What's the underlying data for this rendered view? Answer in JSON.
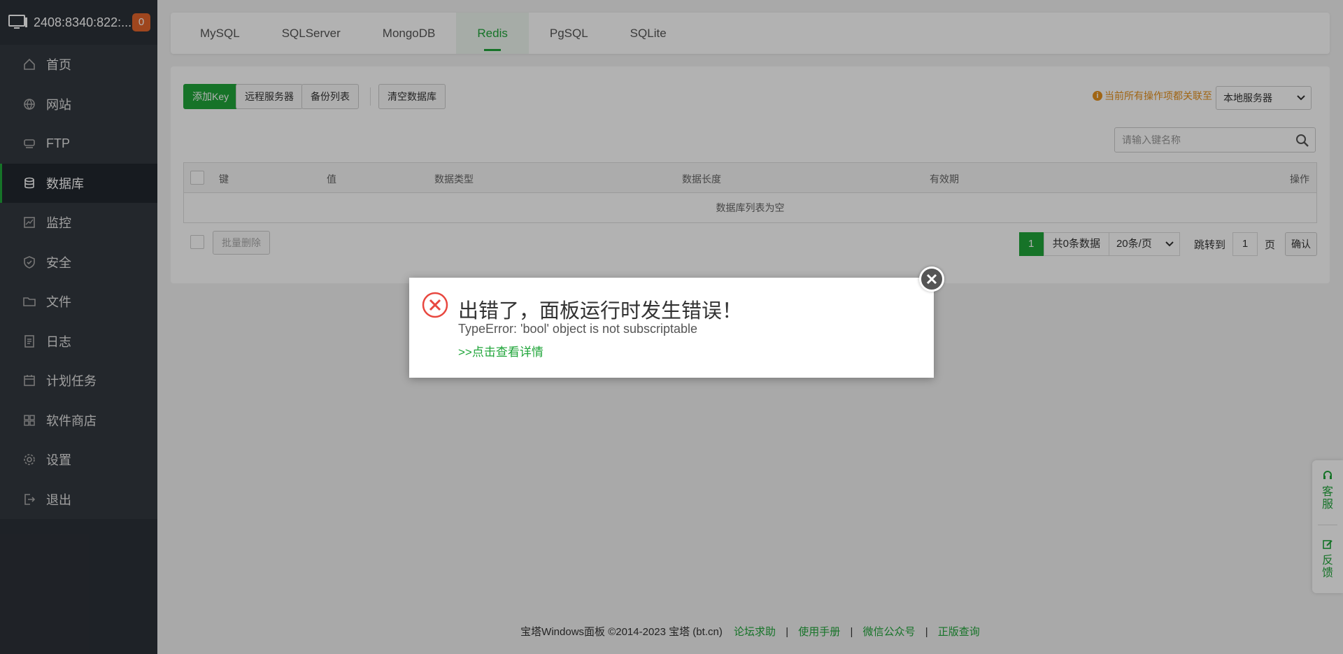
{
  "server": {
    "ip": "2408:8340:822:...",
    "badge": "0"
  },
  "sidebar": {
    "items": [
      {
        "label": "首页",
        "icon": "home-icon"
      },
      {
        "label": "网站",
        "icon": "globe-icon"
      },
      {
        "label": "FTP",
        "icon": "ftp-icon"
      },
      {
        "label": "数据库",
        "icon": "database-icon",
        "active": true
      },
      {
        "label": "监控",
        "icon": "monitor-chart-icon"
      },
      {
        "label": "安全",
        "icon": "shield-icon"
      },
      {
        "label": "文件",
        "icon": "folder-icon"
      },
      {
        "label": "日志",
        "icon": "log-icon"
      },
      {
        "label": "计划任务",
        "icon": "calendar-icon"
      },
      {
        "label": "软件商店",
        "icon": "grid-apps-icon"
      },
      {
        "label": "设置",
        "icon": "gear-icon"
      },
      {
        "label": "退出",
        "icon": "logout-icon"
      }
    ]
  },
  "tabs": [
    "MySQL",
    "SQLServer",
    "MongoDB",
    "Redis",
    "PgSQL",
    "SQLite"
  ],
  "active_tab": "Redis",
  "toolbar": {
    "add_key": "添加Key",
    "remote_server": "远程服务器",
    "backup_list": "备份列表",
    "clear_db": "清空数据库",
    "notice": "当前所有操作项都关联至",
    "server_select": "本地服务器",
    "search_placeholder": "请输入键名称"
  },
  "table": {
    "columns": [
      "键",
      "值",
      "数据类型",
      "数据长度",
      "有效期",
      "操作"
    ],
    "empty_text": "数据库列表为空",
    "batch_delete": "批量删除"
  },
  "pager": {
    "current_page": "1",
    "total": "共0条数据",
    "page_size": "20条/页",
    "goto_label": "跳转到",
    "goto_value": "1",
    "page_unit": "页",
    "confirm": "确认"
  },
  "footer": {
    "copyright": "宝塔Windows面板 ©2014-2023 宝塔 (bt.cn)",
    "links": [
      "论坛求助",
      "使用手册",
      "微信公众号",
      "正版查询"
    ],
    "separator": "|"
  },
  "float_panel": {
    "service": "客服",
    "feedback": "反馈"
  },
  "dialog": {
    "title": "出错了，面板运行时发生错误！",
    "message": "TypeError: 'bool' object is not subscriptable",
    "detail_link": ">>点击查看详情"
  },
  "colors": {
    "accent": "#20a53a",
    "sidebar_bg": "#2c3138",
    "error": "#e8473f",
    "warning": "#e6911e",
    "badge": "#e2652c"
  }
}
